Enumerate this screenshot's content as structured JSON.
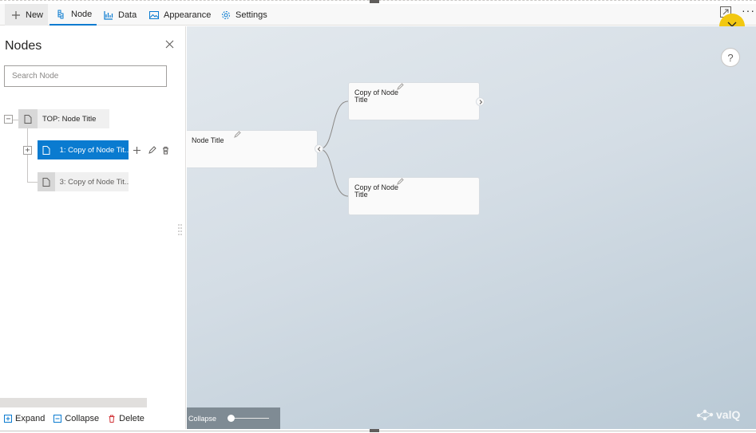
{
  "toolbar": {
    "new_label": "New",
    "node_label": "Node",
    "data_label": "Data",
    "appearance_label": "Appearance",
    "settings_label": "Settings",
    "accent_color": "#0a7bd0",
    "icons": [
      "plus-icon",
      "tree-icon",
      "bar-chart-icon",
      "image-icon",
      "gear-icon",
      "expand-icon",
      "more-icon",
      "close-icon"
    ]
  },
  "panel": {
    "title": "Nodes",
    "search_placeholder": "Search Node",
    "search_value": "",
    "tree": [
      {
        "label": "TOP: Node Title",
        "toggle": "−",
        "selected": false
      },
      {
        "label": "1: Copy of Node Tit...",
        "toggle": "+",
        "selected": true
      },
      {
        "label": "3: Copy of Node Tit...",
        "toggle": "",
        "selected": false
      }
    ],
    "footer": {
      "expand_label": "Expand",
      "collapse_label": "Collapse",
      "delete_label": "Delete"
    }
  },
  "canvas": {
    "root_node": {
      "title": "Node Title"
    },
    "child_nodes": [
      {
        "title_line1": "Copy of Node",
        "title_line2": "Title"
      },
      {
        "title_line1": "Copy of Node",
        "title_line2": "Title"
      }
    ],
    "help_label": "?",
    "collapse_label": "Collapse",
    "logo_text": "valQ",
    "selection_color": "#f2c811"
  }
}
